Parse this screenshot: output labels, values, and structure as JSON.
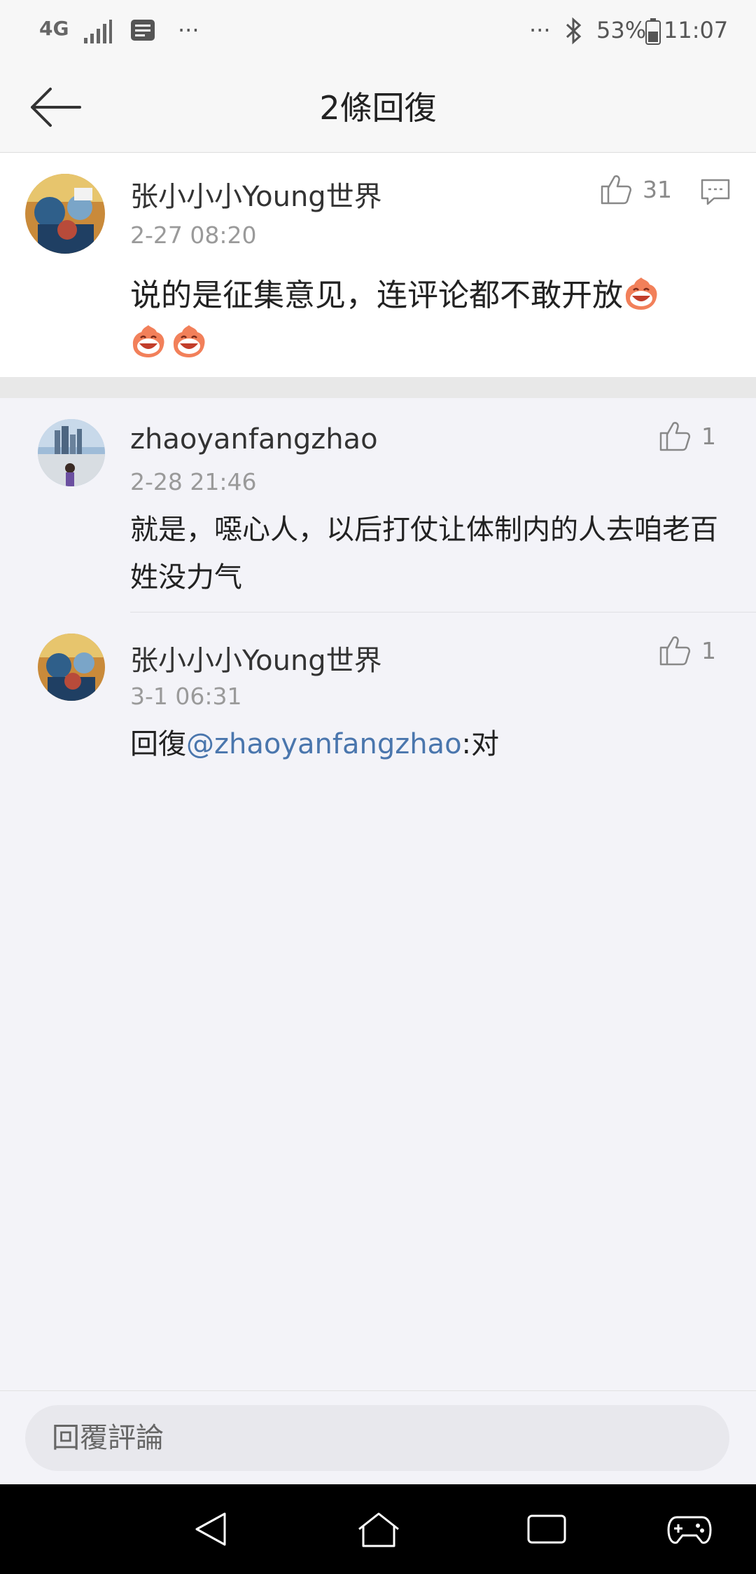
{
  "status_bar": {
    "network": "4G",
    "dots_left": "···",
    "dots_right": "···",
    "battery": "53%",
    "time": "11:07"
  },
  "header": {
    "title": "2條回復",
    "back_icon": "back-arrow-icon"
  },
  "main_comment": {
    "username": "张小小小Young世界",
    "time": "2-27 08:20",
    "like_count": "31",
    "text": "说的是征集意见，连评论都不敢开放",
    "emoji_icon": "laughing-emoji-icon"
  },
  "replies": [
    {
      "username": "zhaoyanfangzhao",
      "time": "2-28 21:46",
      "like_count": "1",
      "text": "就是，噁心人，以后打仗让体制内的人去咱老百姓没力气"
    },
    {
      "username": "张小小小Young世界",
      "time": "3-1 06:31",
      "like_count": "1",
      "prefix": "回復",
      "mention": "@zhaoyanfangzhao",
      "suffix": ":对"
    }
  ],
  "reply_box": {
    "placeholder": "回覆評論"
  },
  "nav_bar": {
    "icons": [
      "back-triangle-icon",
      "home-icon",
      "recents-icon",
      "game-controller-icon"
    ]
  },
  "colors": {
    "mention": "#4a76ad",
    "background": "#f3f3f8",
    "nav": "#000000"
  }
}
